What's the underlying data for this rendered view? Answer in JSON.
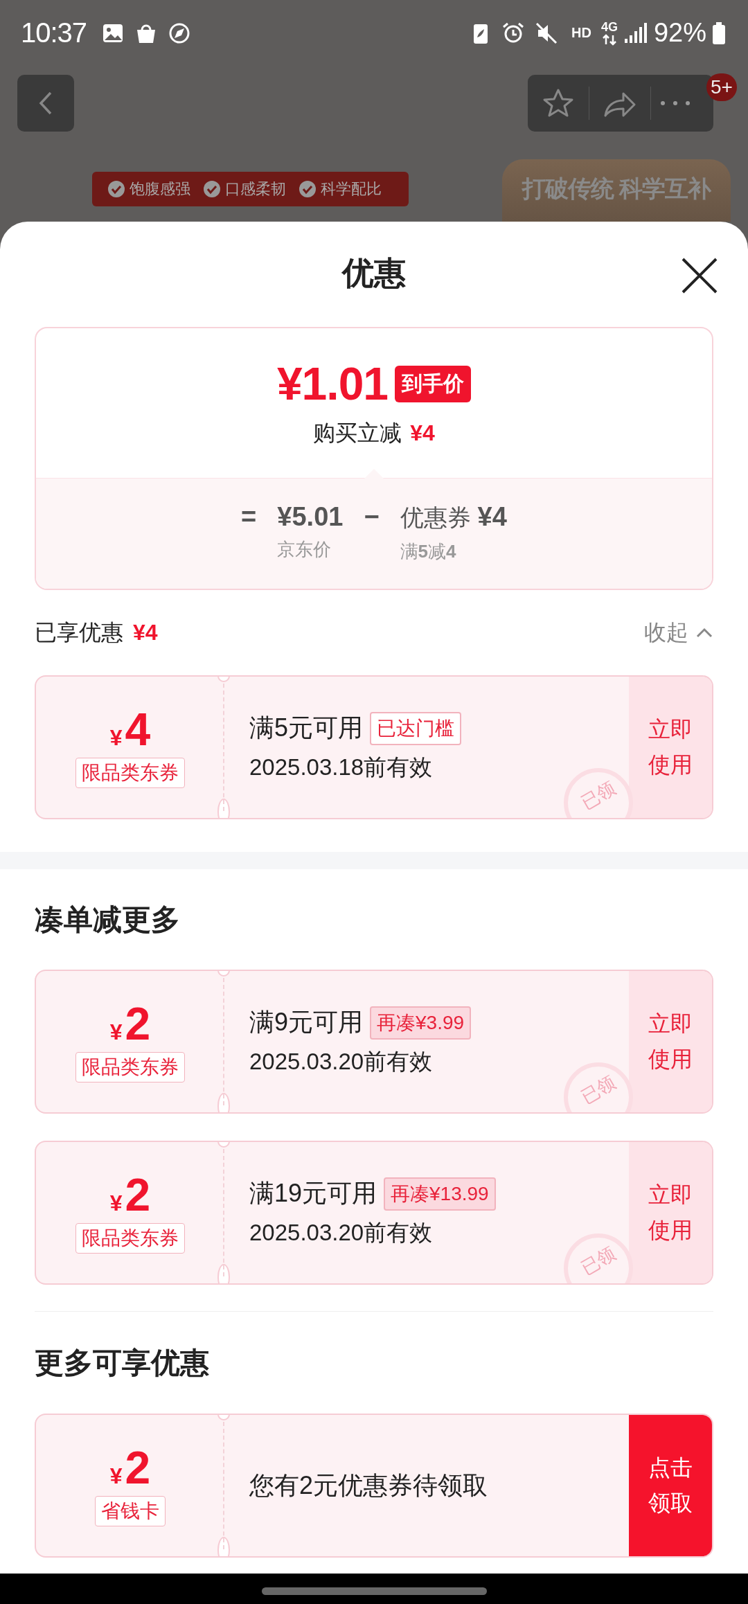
{
  "status_bar": {
    "time": "10:37",
    "hd": "HD",
    "network": "4G",
    "battery": "92%"
  },
  "header": {
    "badge": "5+"
  },
  "background_page": {
    "tags": [
      "饱腹感强",
      "口感柔韧",
      "科学配比"
    ],
    "banner": "打破传统 科学互补"
  },
  "sheet": {
    "title": "优惠"
  },
  "summary": {
    "final_price": "¥1.01",
    "price_tag": "到手价",
    "saving_label": "购买立减",
    "saving_amount": "¥4",
    "equals": "=",
    "jd_price": "¥5.01",
    "jd_price_label": "京东价",
    "minus": "−",
    "coupon_label": "优惠券",
    "coupon_amount": "¥4",
    "coupon_rule": "满**5**减**4**"
  },
  "applied": {
    "label": "已享优惠",
    "amount": "¥4",
    "toggle": "收起",
    "expanded": true,
    "coupons": [
      {
        "currency": "¥",
        "amount": "4",
        "type": "限品类东券",
        "condition": "满5元可用",
        "tag": {
          "text": "已达门槛",
          "kind": "reached"
        },
        "validity": "2025.03.18前有效",
        "action": "立即使用",
        "claimed": true,
        "stamp": "已领"
      }
    ]
  },
  "sections": [
    {
      "title": "凑单减更多",
      "coupons": [
        {
          "currency": "¥",
          "amount": "2",
          "type": "限品类东券",
          "condition": "满9元可用",
          "tag": {
            "text": "再凑¥3.99",
            "kind": "topup"
          },
          "validity": "2025.03.20前有效",
          "action": "立即使用",
          "claimed": true,
          "stamp": "已领"
        },
        {
          "currency": "¥",
          "amount": "2",
          "type": "限品类东券",
          "condition": "满19元可用",
          "tag": {
            "text": "再凑¥13.99",
            "kind": "topup"
          },
          "validity": "2025.03.20前有效",
          "action": "立即使用",
          "claimed": true,
          "stamp": "已领"
        }
      ]
    },
    {
      "title": "更多可享优惠",
      "coupons": [
        {
          "currency": "¥",
          "amount": "2",
          "type": "省钱卡",
          "message": "您有2元优惠券待领取",
          "action": "点击领取",
          "claimed": false
        }
      ]
    }
  ]
}
